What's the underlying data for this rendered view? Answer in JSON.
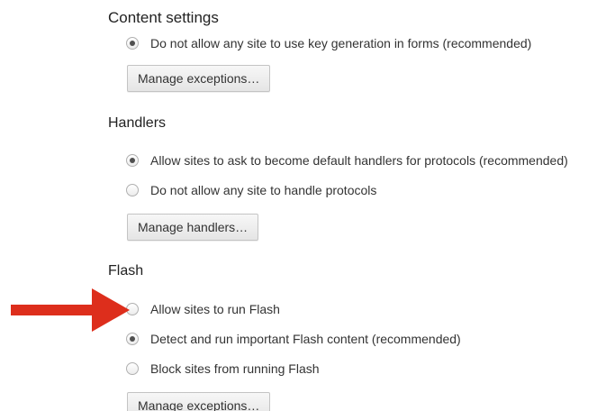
{
  "header": {
    "title": "Content settings"
  },
  "key_generation": {
    "clipped_option_label": "Do not allow any site to use key generation in forms (recommended)",
    "manage_exceptions_label": "Manage exceptions…"
  },
  "handlers": {
    "heading": "Handlers",
    "options": [
      {
        "label": "Allow sites to ask to become default handlers for protocols (recommended)",
        "checked": true
      },
      {
        "label": "Do not allow any site to handle protocols",
        "checked": false
      }
    ],
    "manage_label": "Manage handlers…"
  },
  "flash": {
    "heading": "Flash",
    "options": [
      {
        "label": "Allow sites to run Flash",
        "checked": false
      },
      {
        "label": "Detect and run important Flash content (recommended)",
        "checked": true
      },
      {
        "label": "Block sites from running Flash",
        "checked": false
      }
    ],
    "manage_exceptions_label": "Manage exceptions…"
  },
  "colors": {
    "annotation_arrow": "#dd2e1c"
  },
  "icons": {
    "annotation": "arrow-right-icon"
  }
}
